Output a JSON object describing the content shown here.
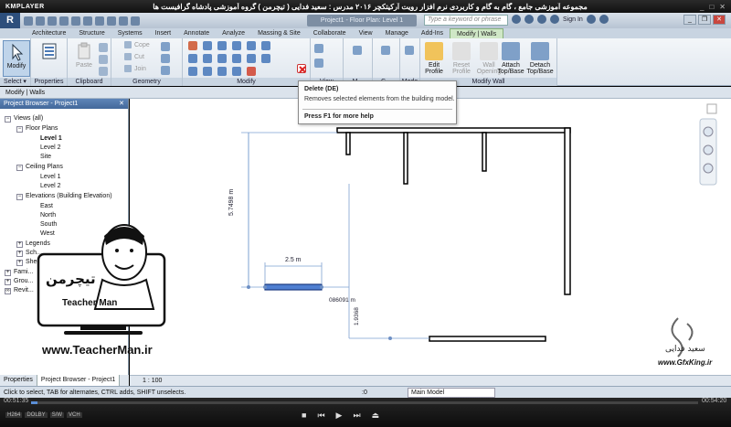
{
  "km": {
    "logo": "KMPLAYER",
    "title": "مجموعه آموزشی جامع ، گام به گام و کاربردی نرم افزار رویت آرکیتکچر ۲۰۱۶  مدرس : سعید فدایی ( تیچرمن ) گروه آموزشی پادشاه گرافیست ها",
    "time_current": "00:51:35",
    "time_total": "00:54:20",
    "progress": 0.01,
    "chips": [
      "H264",
      "DOLBY",
      "S/W",
      "VCH"
    ]
  },
  "revit": {
    "logo": "R",
    "doc_tab": "Project1 - Floor Plan: Level 1",
    "search_placeholder": "Type a keyword or phrase",
    "sign_in": "Sign In"
  },
  "tabs": [
    "Architecture",
    "Structure",
    "Systems",
    "Insert",
    "Annotate",
    "Analyze",
    "Massing & Site",
    "Collaborate",
    "View",
    "Manage",
    "Add-Ins",
    "Modify | Walls"
  ],
  "ribbon": {
    "modify_label": "Modify",
    "properties_label": "Properties",
    "paste_label": "Paste",
    "clipboard_items": [
      "Cope",
      "Cut",
      "Join"
    ],
    "panels": {
      "select": "Select ▾",
      "properties": "Properties",
      "clipboard": "Clipboard",
      "geometry": "Geometry",
      "modify": "Modify",
      "view": "View",
      "measure": "M...",
      "create": "C...",
      "mode": "Mode",
      "modify_wall": "Modify Wall"
    },
    "edit_profile": "Edit Profile",
    "reset_profile": "Reset Profile",
    "wall_opening": "Wall Opening",
    "attach": "Attach Top/Base",
    "detach": "Detach Top/Base"
  },
  "optbar": "Modify | Walls",
  "tooltip": {
    "title": "Delete (DE)",
    "desc": "Removes selected elements from the building model.",
    "help": "Press F1 for more help"
  },
  "browser": {
    "title": "Project Browser - Project1",
    "views": "Views (all)",
    "floor_plans": "Floor Plans",
    "level1": "Level 1",
    "level2": "Level 2",
    "site": "Site",
    "ceiling_plans": "Ceiling Plans",
    "c_level1": "Level 1",
    "c_level2": "Level 2",
    "elevations": "Elevations (Building Elevation)",
    "east": "East",
    "north": "North",
    "south": "South",
    "west": "West",
    "legends": "Legends",
    "schedules": "Sch...",
    "sheets": "Shee...",
    "families": "Fami...",
    "groups": "Grou...",
    "revit_links": "Revit..."
  },
  "browser_tabs": [
    "Properties",
    "Project Browser - Project1"
  ],
  "viewbar": {
    "scale": "1 : 100"
  },
  "dimensions": {
    "vertical": "5.7498 m",
    "width": "2.5 m",
    "small1": "086091 m",
    "small2": "1.9368"
  },
  "status": {
    "hint": "Click to select, TAB for alternates, CTRL adds, SHIFT unselects.",
    "zero": ":0",
    "model": "Main Model"
  },
  "watermark": {
    "teacher_fa": "تیچرمن",
    "teacher_en": "Teacher Man",
    "url": "www.TeacherMan.ir",
    "gfx_name": "سعید فدایی",
    "gfx_url": "www.GfxKing.ir"
  }
}
